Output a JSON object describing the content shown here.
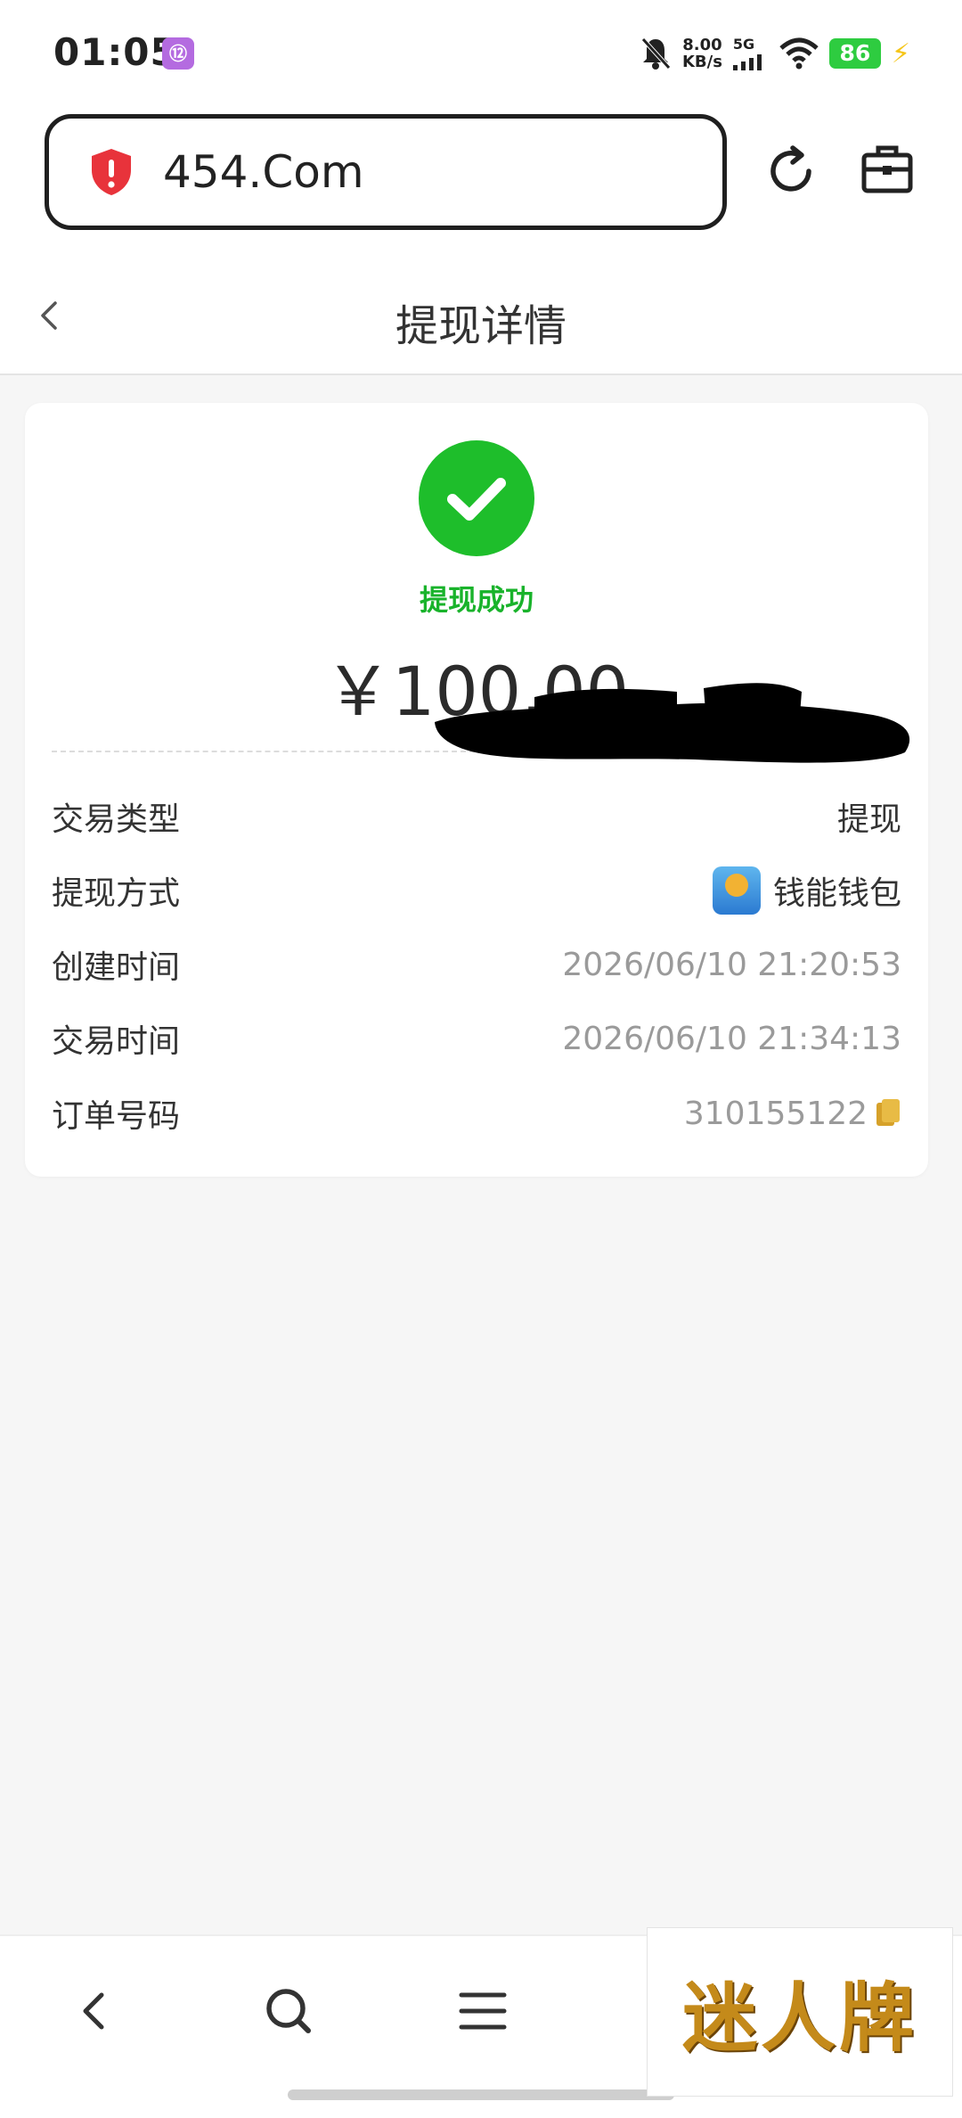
{
  "status_bar": {
    "time": "01:05",
    "app_icon_glyph": "⑫",
    "net_speed_value": "8.00",
    "net_speed_unit": "KB/s",
    "network_type": "5G",
    "battery": "86"
  },
  "browser": {
    "url": "454.Com",
    "security_icon": "shield-warning-icon",
    "reload_icon": "reload-icon",
    "toolbox_icon": "toolbox-icon"
  },
  "header": {
    "title": "提现详情"
  },
  "result": {
    "status": "提现成功",
    "amount": "￥100.00",
    "status_color": "#1ebe2b"
  },
  "details": [
    {
      "label": "交易类型",
      "value": "提现"
    },
    {
      "label": "提现方式",
      "value": "钱能钱包"
    },
    {
      "label": "创建时间",
      "value": "2026/06/10 21:20:53"
    },
    {
      "label": "交易时间",
      "value": "2026/06/10 21:34:13"
    },
    {
      "label": "订单号码",
      "value": "310155122"
    }
  ],
  "bottom_nav": {
    "items": [
      "back-icon",
      "search-icon",
      "menu-icon"
    ]
  },
  "watermark": {
    "text": "迷人牌"
  }
}
